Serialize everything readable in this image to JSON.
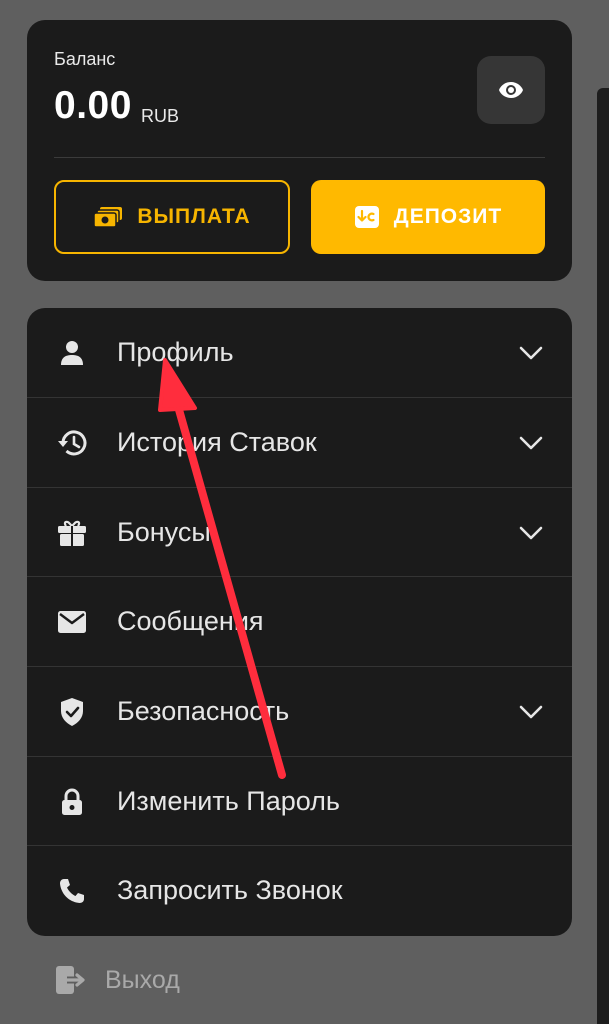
{
  "balance": {
    "label": "Баланс",
    "amount": "0.00",
    "currency": "RUB"
  },
  "actions": {
    "payout_label": "ВЫПЛАТА",
    "deposit_label": "ДЕПОЗИТ"
  },
  "menu": {
    "items": [
      {
        "label": "Профиль",
        "icon": "user-icon",
        "expandable": true
      },
      {
        "label": "История Ставок",
        "icon": "history-icon",
        "expandable": true
      },
      {
        "label": "Бонусы",
        "icon": "gift-icon",
        "expandable": true
      },
      {
        "label": "Сообщения",
        "icon": "mail-icon",
        "expandable": false
      },
      {
        "label": "Безопасность",
        "icon": "shield-icon",
        "expandable": true
      },
      {
        "label": "Изменить Пароль",
        "icon": "lock-icon",
        "expandable": false
      },
      {
        "label": "Запросить Звонок",
        "icon": "phone-icon",
        "expandable": false
      }
    ]
  },
  "logout": {
    "label": "Выход",
    "icon": "logout-icon"
  },
  "colors": {
    "accent": "#ffb900",
    "card": "#1b1b1b",
    "background": "#5f5f5f",
    "annotation": "#ff2d3d"
  }
}
